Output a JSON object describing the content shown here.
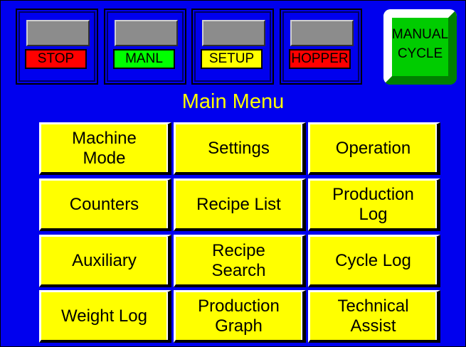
{
  "status_indicators": [
    {
      "label": "STOP",
      "label_bg": "#ff0000"
    },
    {
      "label": "MANL",
      "label_bg": "#00ff00"
    },
    {
      "label": "SETUP",
      "label_bg": "#ffff00"
    },
    {
      "label": "HOPPER",
      "label_bg": "#ff0000"
    }
  ],
  "manual_cycle": {
    "line1": "MANUAL",
    "line2": "CYCLE"
  },
  "title": "Main Menu",
  "menu": [
    "Machine\nMode",
    "Settings",
    "Operation",
    "Counters",
    "Recipe List",
    "Production\nLog",
    "Auxiliary",
    "Recipe\nSearch",
    "Cycle Log",
    "Weight Log",
    "Production\nGraph",
    "Technical\nAssist"
  ],
  "colors": {
    "screen_bg": "#0000ee",
    "button_bg": "#ffff00",
    "title_color": "#ffff00",
    "manual_cycle_bg": "#00cc00"
  }
}
